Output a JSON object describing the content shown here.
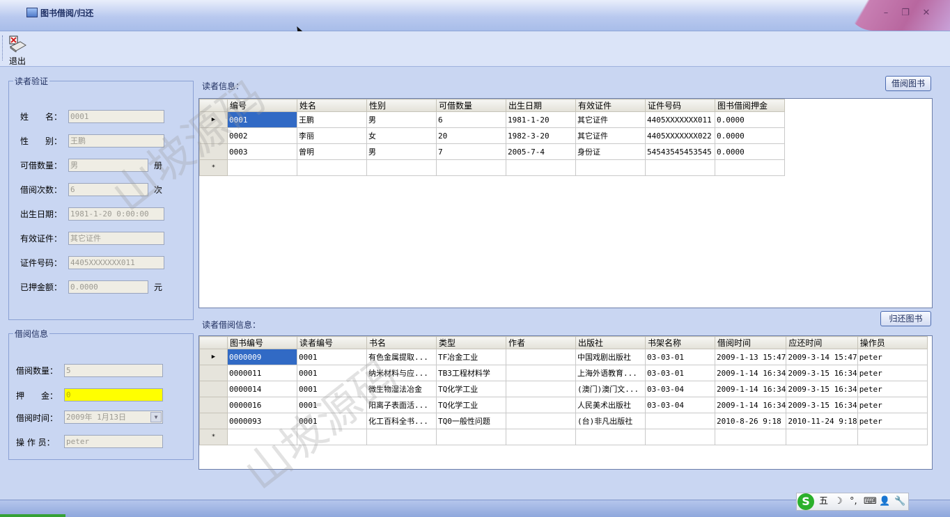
{
  "window": {
    "title": "图书借阅/归还",
    "minimize": "–",
    "restore": "❐",
    "close": "✕"
  },
  "toolbar": {
    "exit_label": "退出"
  },
  "reader_verify": {
    "legend": "读者验证",
    "fields": [
      {
        "label": "姓　　名：",
        "value": "0001"
      },
      {
        "label": "性　　别：",
        "value": "王鹏"
      },
      {
        "label": "可借数量：",
        "value": "男",
        "unit": "册"
      },
      {
        "label": "借阅次数：",
        "value": "6",
        "unit": "次"
      },
      {
        "label": "出生日期：",
        "value": "1981-1-20 0:00:00"
      },
      {
        "label": "有效证件：",
        "value": "其它证件"
      },
      {
        "label": "证件号码：",
        "value": "4405XXXXXXX011"
      },
      {
        "label": "已押金额：",
        "value": "0.0000",
        "unit": "元"
      }
    ]
  },
  "borrow_info": {
    "legend": "借阅信息",
    "fields": [
      {
        "label": "借阅数量：",
        "value": "5"
      },
      {
        "label": "押　　金：",
        "value": "0"
      },
      {
        "label": "借阅时间：",
        "value": "2009年 1月13日"
      },
      {
        "label": "操 作 员：",
        "value": "peter"
      }
    ]
  },
  "reader_grid": {
    "label": "读者信息：",
    "button": "借阅图书",
    "columns": [
      "编号",
      "姓名",
      "性别",
      "可借数量",
      "出生日期",
      "有效证件",
      "证件号码",
      "图书借阅押金"
    ],
    "rows": [
      [
        "0001",
        "王鹏",
        "男",
        "6",
        "1981-1-20",
        "其它证件",
        "4405XXXXXXX011",
        "0.0000"
      ],
      [
        "0002",
        "李丽",
        "女",
        "20",
        "1982-3-20",
        "其它证件",
        "4405XXXXXXX022",
        "0.0000"
      ],
      [
        "0003",
        "曾明",
        "男",
        "7",
        "2005-7-4",
        "身份证",
        "54543545453545",
        "0.0000"
      ]
    ],
    "new_row_marker": "*",
    "current_row_marker": "▶"
  },
  "borrow_grid": {
    "label": "读者借阅信息：",
    "button": "归还图书",
    "columns": [
      "图书编号",
      "读者编号",
      "书名",
      "类型",
      "作者",
      "出版社",
      "书架名称",
      "借阅时间",
      "应还时间",
      "操作员"
    ],
    "rows": [
      [
        "0000009",
        "0001",
        "有色金属提取...",
        "TF冶金工业",
        "",
        "中国戏剧出版社",
        "03-03-01",
        "2009-1-13 15:47",
        "2009-3-14 15:47",
        "peter"
      ],
      [
        "0000011",
        "0001",
        "纳米材料与应...",
        "TB3工程材料学",
        "",
        "上海外语教育...",
        "03-03-01",
        "2009-1-14 16:34",
        "2009-3-15 16:34",
        "peter"
      ],
      [
        "0000014",
        "0001",
        "微生物湿法冶金",
        "TQ化学工业",
        "",
        "(澳门)澳门文...",
        "03-03-04",
        "2009-1-14 16:34",
        "2009-3-15 16:34",
        "peter"
      ],
      [
        "0000016",
        "0001",
        "阳离子表面活...",
        "TQ化学工业",
        "",
        "人民美术出版社",
        "03-03-04",
        "2009-1-14 16:34",
        "2009-3-15 16:34",
        "peter"
      ],
      [
        "0000093",
        "0001",
        "化工百科全书...",
        "TQ0一般性问题",
        "",
        "(台)非凡出版社",
        "",
        "2010-8-26 9:18",
        "2010-11-24 9:18",
        "peter"
      ]
    ]
  },
  "ime_bar": {
    "logo": "S",
    "items": [
      "五",
      "☽",
      "°,",
      "⌨",
      "👤",
      "🔧"
    ]
  },
  "watermarks": [
    "山坡源码",
    "山坡源码"
  ]
}
